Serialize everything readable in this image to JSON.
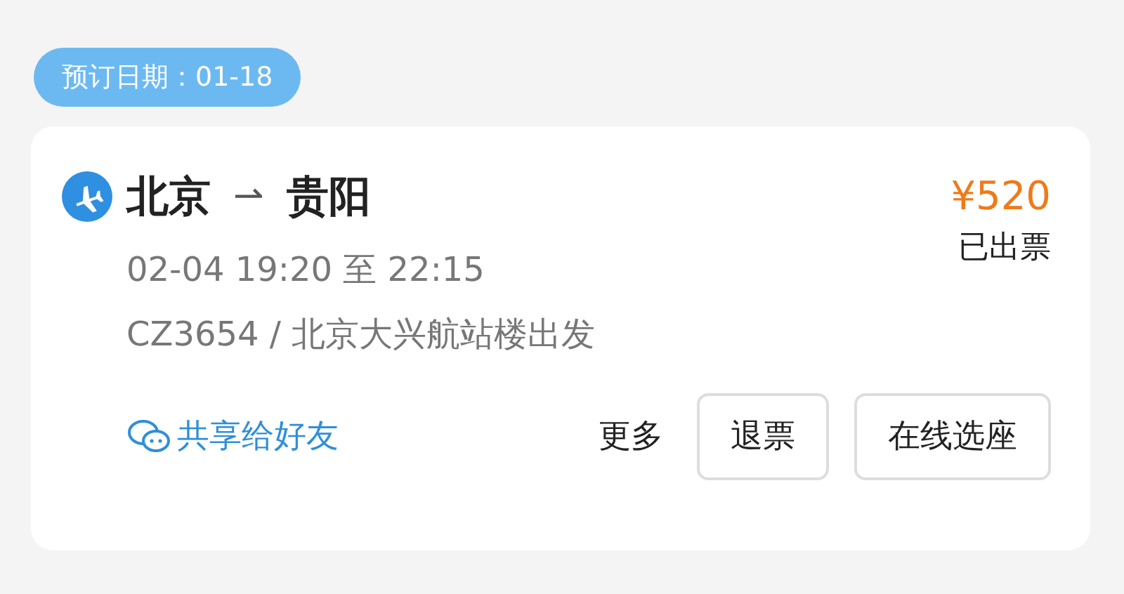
{
  "booking_date_badge": "预订日期：01-18",
  "order": {
    "from": "北京",
    "arrow": "⇀",
    "to": "贵阳",
    "time": "02-04 19:20 至 22:15",
    "flight": "CZ3654 / 北京大兴航站楼出发",
    "price": "¥520",
    "status": "已出票"
  },
  "actions": {
    "share": "共享给好友",
    "more": "更多",
    "buttons": [
      "退票",
      "在线选座"
    ]
  }
}
